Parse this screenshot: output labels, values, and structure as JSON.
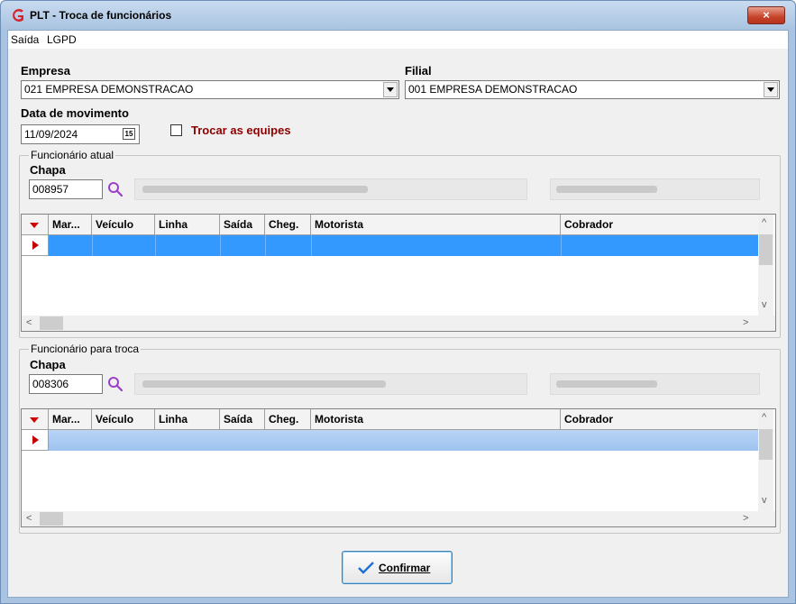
{
  "window": {
    "title": "PLT - Troca de funcionários",
    "close_label": "×"
  },
  "menu": {
    "saida": "Saída",
    "lgpd": "LGPD"
  },
  "empresa": {
    "label": "Empresa",
    "value": "021 EMPRESA DEMONSTRACAO"
  },
  "filial": {
    "label": "Filial",
    "value": "001 EMPRESA DEMONSTRACAO"
  },
  "data_movimento": {
    "label": "Data de movimento",
    "value": "11/09/2024",
    "calendar_glyph": "15"
  },
  "trocar_equipes": {
    "label": "Trocar as equipes",
    "checked": false,
    "label_color": "#8b0000"
  },
  "funcionario_atual": {
    "group_title": "Funcionário atual",
    "chapa_label": "Chapa",
    "chapa_value": "008957"
  },
  "funcionario_troca": {
    "group_title": "Funcionário para troca",
    "chapa_label": "Chapa",
    "chapa_value": "008306"
  },
  "grid_columns": [
    "Mar...",
    "Veículo",
    "Linha",
    "Saída",
    "Cheg.",
    "Motorista",
    "Cobrador"
  ],
  "scroll_glyphs": {
    "up": "^",
    "down": "v",
    "left": "<",
    "right": ">"
  },
  "confirm_button": {
    "label": "Confirmar"
  },
  "colors": {
    "selection": "#3399ff",
    "indicator": "#c00000",
    "accent_border": "#3c7fb1"
  }
}
